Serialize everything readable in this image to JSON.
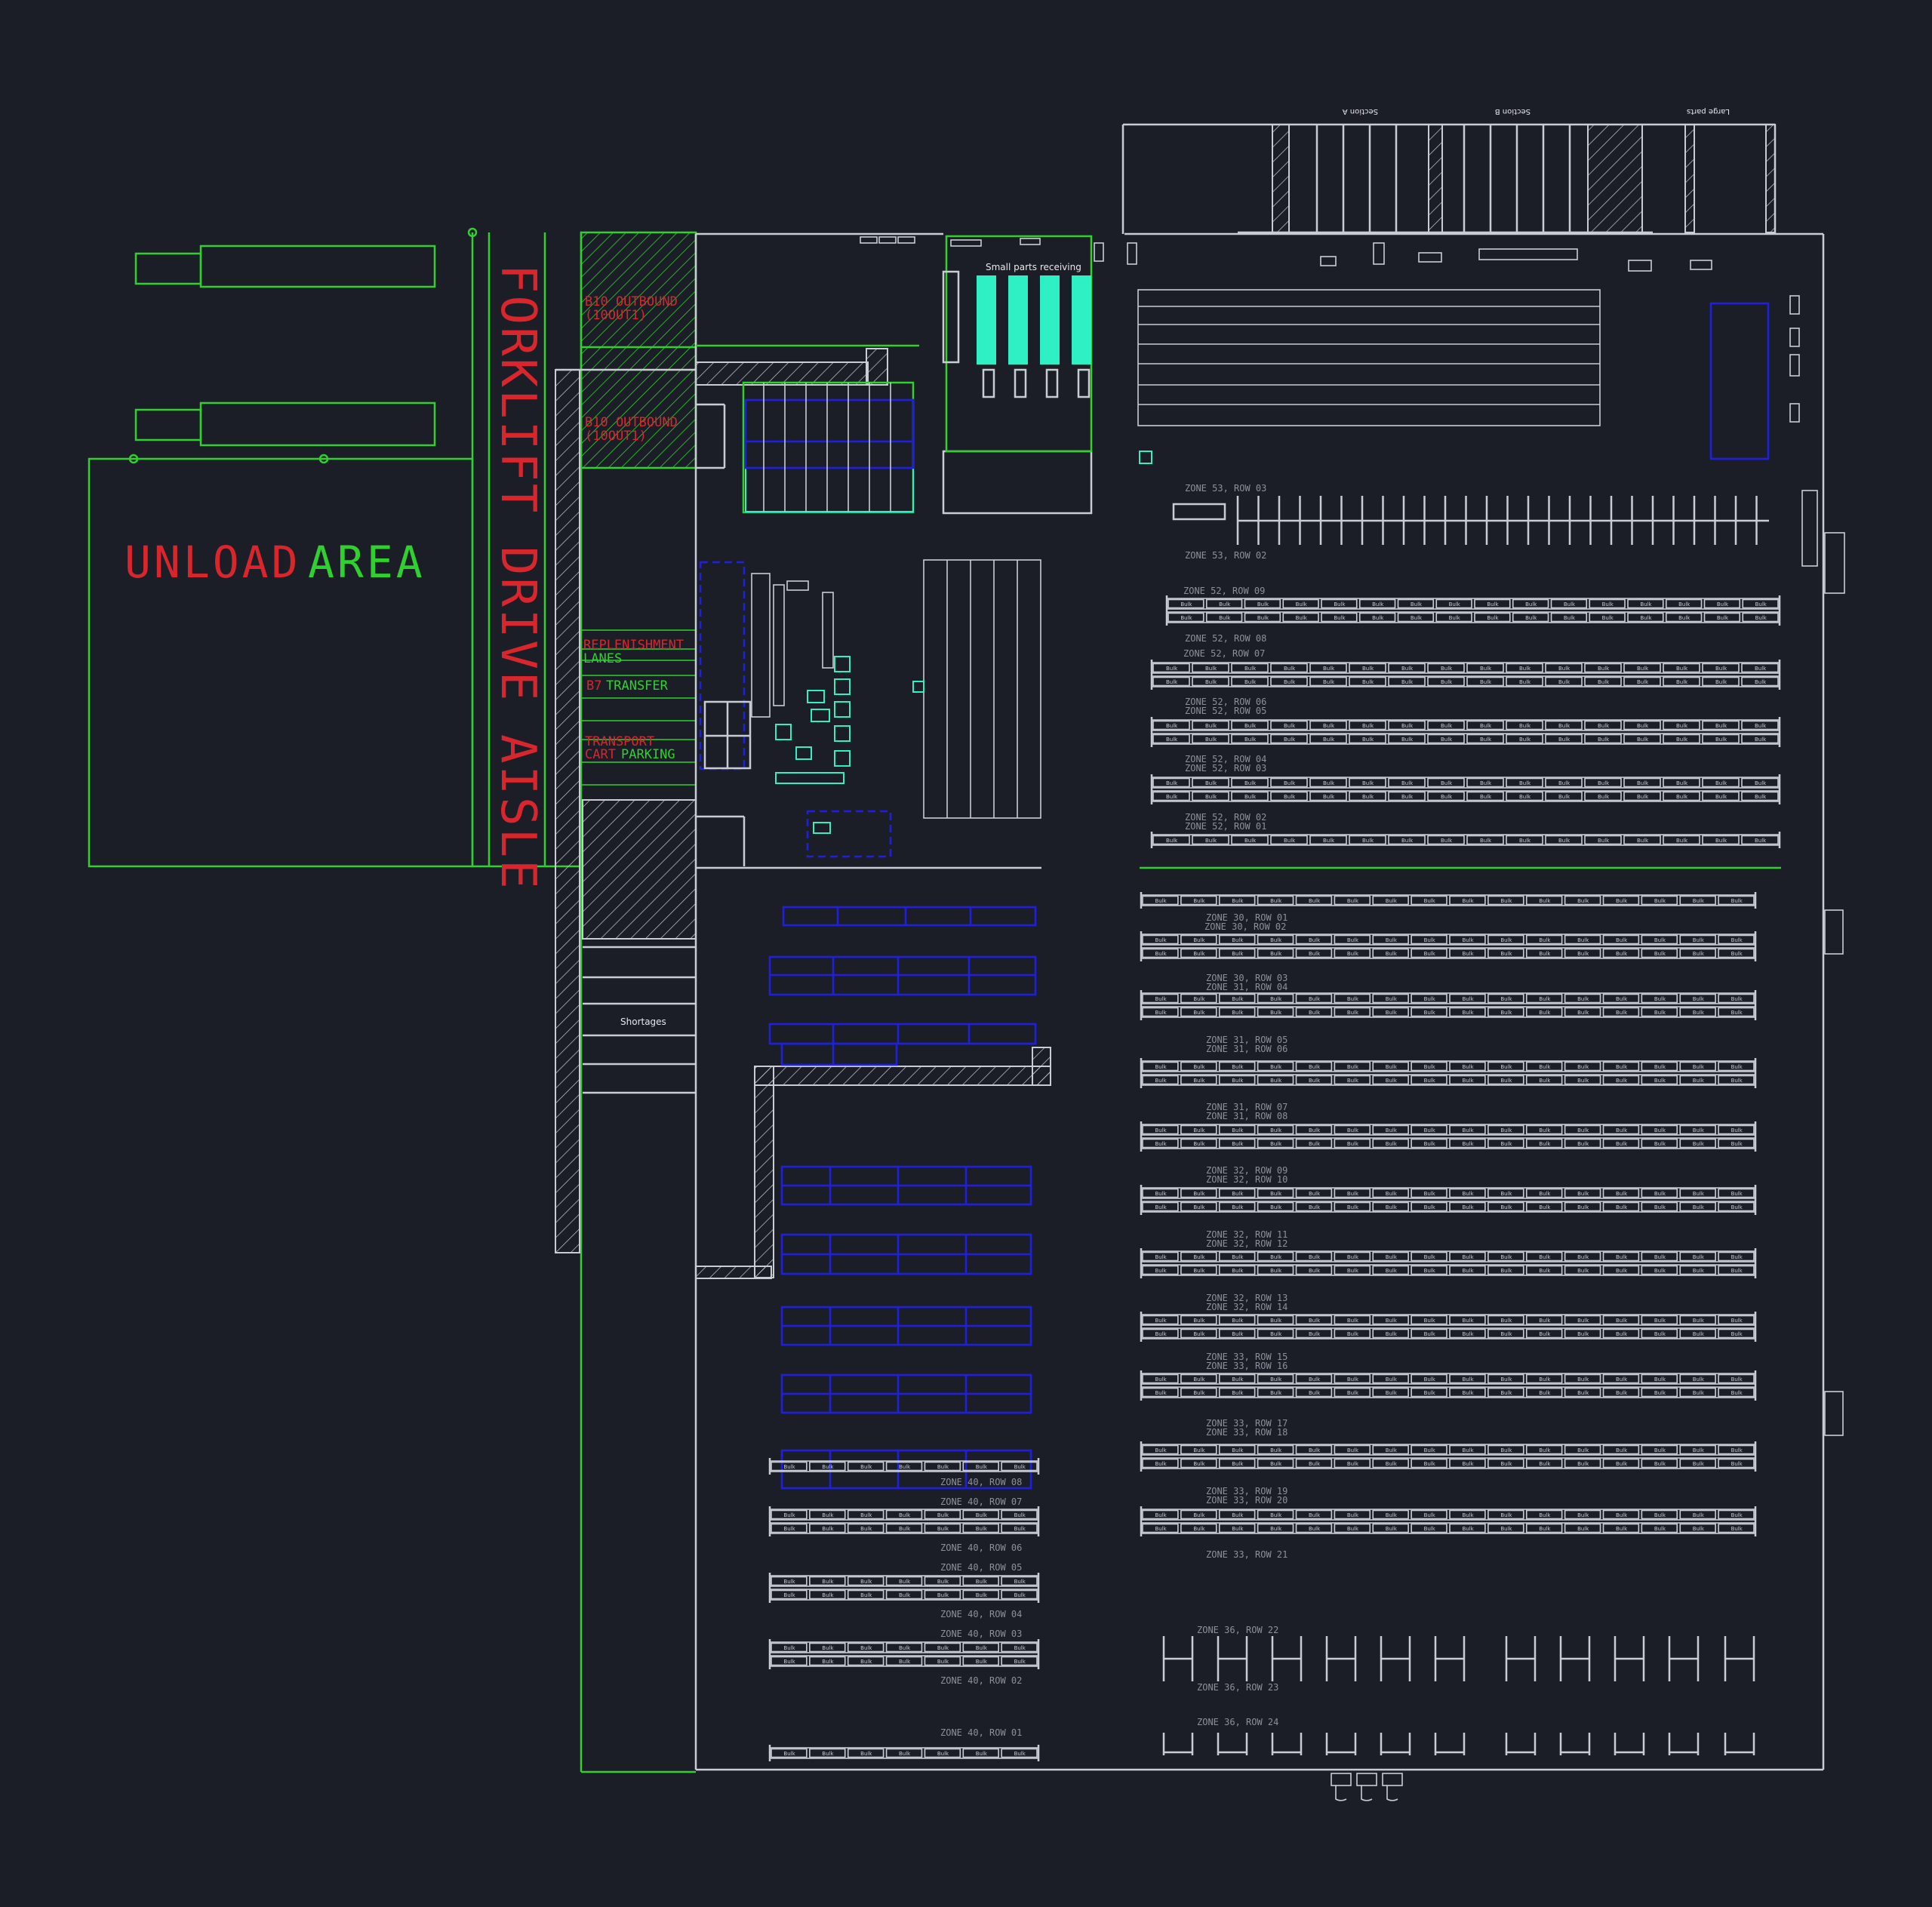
{
  "colors": {
    "background": "#1c1e27",
    "wall": "#c9ccd3",
    "green": "#2fd02f",
    "red": "#d9262c",
    "blue": "#1f1fe0",
    "cyan": "#2ef0c4"
  },
  "labels": {
    "unload_word1": "UNLOAD",
    "unload_word2": "AREA",
    "aisle": "FORKLIFT DRIVE AISLE",
    "outbound1_l1": "B10 OUTBOUND",
    "outbound1_l2": "(10OUT1)",
    "outbound2_l1": "B10 OUTBOUND",
    "outbound2_l2": "(10OUT1)",
    "replen_l1": "REPLENISHMENT",
    "replen_l2": "LANES",
    "transfer_prefix": "B7",
    "transfer_word": "TRANSFER",
    "transport_l1": "TRANSPORT",
    "transport_cart": "CART",
    "transport_parking": "PARKING",
    "shortages": "Shortages",
    "small_parts": "Small parts receiving",
    "section_a": "Section A",
    "section_b": "Section B",
    "large_parts": "Large parts"
  },
  "zone_labels": [
    "ZONE 53, ROW 03",
    "ZONE 53, ROW 02",
    "ZONE   52, ROW 09",
    "ZONE 52, ROW 08",
    "ZONE   52, ROW 07",
    "ZONE 52, ROW 06",
    "ZONE 52, ROW 05",
    "ZONE 52, ROW 04",
    "ZONE 52, ROW 03",
    "ZONE 52, ROW 02",
    "ZONE 52, ROW 01",
    "ZONE 30, ROW 01",
    "ZONE   30, ROW 02",
    "ZONE 30, ROW 03",
    "ZONE 31, ROW 04",
    "ZONE 31, ROW 05",
    "ZONE 31, ROW 06",
    "ZONE 31, ROW 07",
    "ZONE 31, ROW 08",
    "ZONE 32, ROW 09",
    "ZONE 32, ROW 10",
    "ZONE 32, ROW 11",
    "ZONE 32, ROW 12",
    "ZONE 32, ROW 13",
    "ZONE 32, ROW 14",
    "ZONE 33, ROW 15",
    "ZONE 33, ROW 16",
    "ZONE 33, ROW 17",
    "ZONE 33, ROW 18",
    "ZONE 33, ROW 19",
    "ZONE 33, ROW 20",
    "ZONE 33, ROW 21",
    "ZONE 36, ROW 22",
    "ZONE 36, ROW 23",
    "ZONE 36, ROW 24",
    "ZONE 40, ROW 08",
    "ZONE 40, ROW 07",
    "ZONE 40, ROW 06",
    "ZONE 40, ROW 05",
    "ZONE 40, ROW 04",
    "ZONE 40, ROW 03",
    "ZONE 40, ROW 02",
    "ZONE 40, ROW 01"
  ],
  "bay_label": "Bulk"
}
